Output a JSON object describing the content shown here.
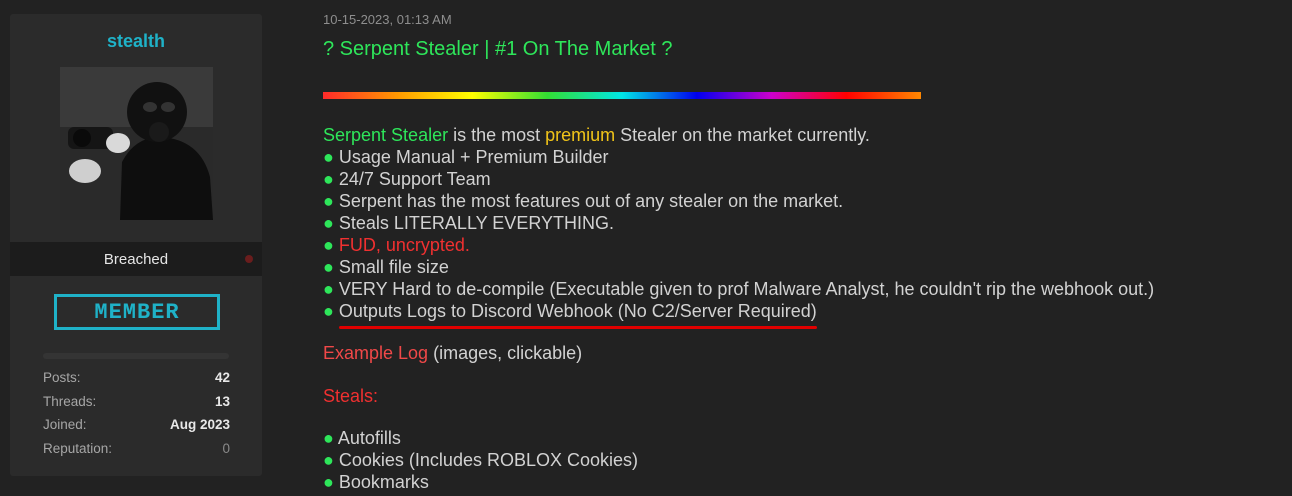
{
  "sidebar": {
    "username": "stealth",
    "usergroup": "Breached",
    "badge": "MEMBER",
    "stats": [
      {
        "label": "Posts:",
        "value": "42"
      },
      {
        "label": "Threads:",
        "value": "13"
      },
      {
        "label": "Joined:",
        "value": "Aug 2023"
      },
      {
        "label": "Reputation:",
        "value": "0"
      }
    ]
  },
  "post": {
    "date": "10-15-2023, 01:13 AM",
    "title": "? Serpent Stealer | #1 On The Market ?",
    "intro": {
      "name": "Serpent Stealer",
      "mid": " is the most ",
      "highlight": "premium",
      "end": " Stealer on the market currently."
    },
    "bullet": "●",
    "features": [
      {
        "text": "Usage Manual + Premium Builder",
        "style": "normal"
      },
      {
        "text": "24/7 Support Team",
        "style": "normal"
      },
      {
        "text": "Serpent has the most features out of any stealer on the market.",
        "style": "normal"
      },
      {
        "text": "Steals LITERALLY EVERYTHING.",
        "style": "normal"
      },
      {
        "text": "FUD, uncrypted.",
        "style": "red"
      },
      {
        "text": "Small file size",
        "style": "normal"
      },
      {
        "text": "VERY Hard to de-compile (Executable given to prof Malware Analyst, he couldn't rip the webhook out.)",
        "style": "normal"
      },
      {
        "text": "Outputs Logs to Discord Webhook (No C2/Server Required)",
        "style": "underline"
      }
    ],
    "example_log_link": "Example Log",
    "example_log_note": " (images, clickable)",
    "steals_heading": "Steals:",
    "steals": [
      "Autofills",
      "Cookies (Includes ROBLOX Cookies)",
      "Bookmarks"
    ]
  },
  "colors": {
    "accent_cyan": "#1fb2c8",
    "green": "#2ee65a",
    "gold": "#f0c419",
    "red": "#f03030"
  }
}
